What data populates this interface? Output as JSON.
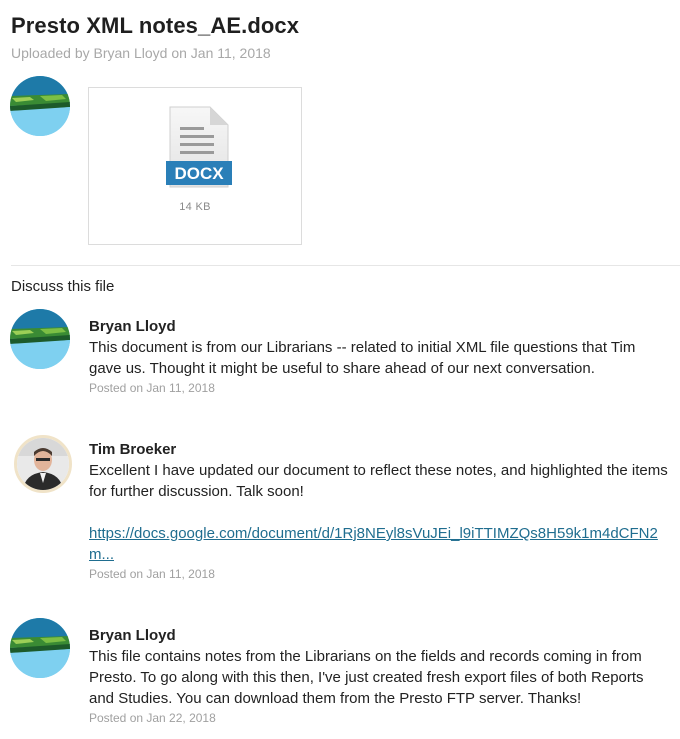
{
  "file": {
    "title": "Presto XML notes_AE.docx",
    "uploaded_by": "Uploaded by Bryan Lloyd on Jan 11, 2018",
    "type_label": "DOCX",
    "size": "14 KB"
  },
  "discussion": {
    "heading": "Discuss this file",
    "comments": [
      {
        "author": "Bryan Lloyd",
        "body": "This document is from our Librarians -- related to initial XML file questions that Tim gave us. Thought it might be useful to share ahead of our next conversation.",
        "posted": "Posted on Jan 11, 2018",
        "avatar": "landscape-avatar"
      },
      {
        "author": "Tim Broeker",
        "body": "Excellent I have updated our document to reflect these notes, and highlighted the items for further discussion. Talk soon!",
        "link": "https://docs.google.com/document/d/1Rj8NEyl8sVuJEi_l9iTTIMZQs8H59k1m4dCFN2m...",
        "posted": "Posted on Jan 11, 2018",
        "avatar": "photo-avatar"
      },
      {
        "author": "Bryan Lloyd",
        "body": "This file contains notes from the Librarians on the fields and records coming in from Presto. To go along with this then, I've just created fresh export files of both Reports and Studies. You can download them from the Presto FTP server. Thanks!",
        "posted": "Posted on Jan 22, 2018",
        "avatar": "landscape-avatar"
      }
    ]
  },
  "colors": {
    "docx_blue": "#2a7fb8",
    "link": "#1f6d8f",
    "meta_gray": "#a0a0a0"
  }
}
